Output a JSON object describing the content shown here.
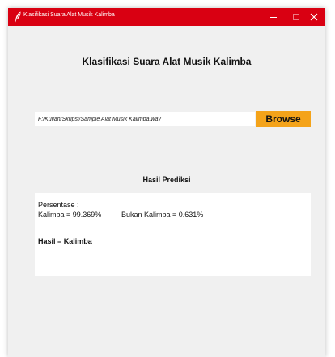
{
  "window": {
    "title": "Klasifikasi Suara Alat Musik Kalimba",
    "titlebar_color": "#d90012",
    "buttons": {
      "minimize_icon": "minimize-icon",
      "maximize_icon": "maximize-icon",
      "close_icon": "close-icon"
    }
  },
  "main": {
    "heading": "Klasifikasi Suara Alat Musik Kalimba",
    "file_path_value": "F:/Kuliah/Skripsi/Sample Alat Musik Kalimba.wav",
    "browse_label": "Browse",
    "browse_color": "#f4a31a"
  },
  "result": {
    "title": "Hasil Prediksi",
    "percentage_label": "Persentase :",
    "kalimba_text": "Kalimba = 99.369%",
    "bukan_kalimba_text": "Bukan Kalimba = 0.631%",
    "final_text": "Hasil = Kalimba"
  }
}
